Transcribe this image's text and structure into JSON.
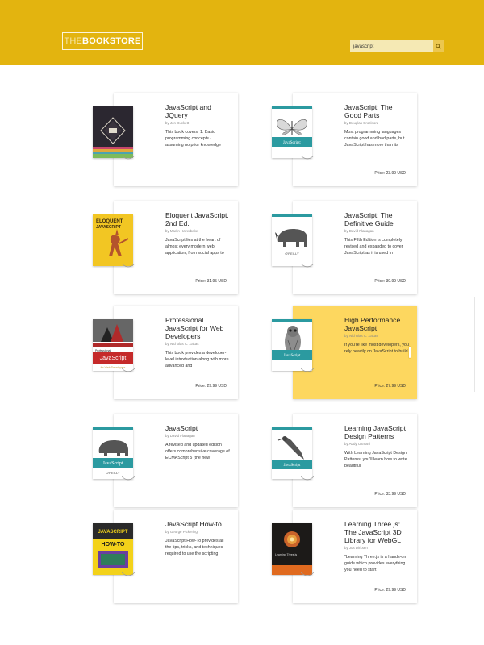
{
  "header": {
    "logo_part1": "THE",
    "logo_part2": "BOOKSTORE",
    "search_value": "javascript",
    "search_icon": "search-icon"
  },
  "books": [
    {
      "title": "JavaScript and JQuery",
      "author": "by Jon Duckett",
      "desc": "This book covers: 1. Basic programming concepts - assuming no prior knowledge",
      "price": ""
    },
    {
      "title": "JavaScript: The Good Parts",
      "author": "by Douglas Crockford",
      "desc": "Most programming languages contain good and bad parts, but JavaScript has more than its",
      "price": "Price: 23.99 USD"
    },
    {
      "title": "Eloquent JavaScript, 2nd Ed.",
      "author": "by Marijn Haverbeke",
      "desc": "JavaScript lies at the heart of almost every modern web application, from social apps to",
      "price": "Price: 31.95 USD"
    },
    {
      "title": "JavaScript: The Definitive Guide",
      "author": "by David Flanagan",
      "desc": "This Fifth Edition is completely revised and expanded to cover JavaScript as it is used in",
      "price": "Price: 39.99 USD"
    },
    {
      "title": "Professional JavaScript for Web Developers",
      "author": "by Nicholas C. Zakas",
      "desc": "This book provides a developer-level introduction along with more advanced and",
      "price": "Price: 29.99 USD"
    },
    {
      "title": "High Performance JavaScript",
      "author": "by Nicholas C. Zakas",
      "desc": "If you're like most developers, you rely heavily on JavaScript to build",
      "price": "Price: 27.99 USD"
    },
    {
      "title": "JavaScript",
      "author": "by David Flanagan",
      "desc": "A revised and updated edition offers comprehensive coverage of ECMAScript 5 (the new",
      "price": ""
    },
    {
      "title": "Learning JavaScript Design Patterns",
      "author": "by Addy Osmani",
      "desc": "With Learning JavaScript Design Patterns, you'll learn how to write beautiful,",
      "price": "Price: 33.99 USD"
    },
    {
      "title": "JavaScript How-to",
      "author": "by George Pickering",
      "desc": "JavaScript How-To provides all the tips, tricks, and techniques required to use the scripting",
      "price": ""
    },
    {
      "title": "Learning Three.js: The JavaScript 3D Library for WebGL",
      "author": "by Jos Dirksen",
      "desc": "\"Learning Three.js is a hands-on guide which provides everything you need to start",
      "price": "Price: 29.99 USD"
    }
  ],
  "covers": {
    "jsjq_text": "JAVASCRIPT & JQUERY",
    "good_parts_text": "JavaScript: The Good Parts",
    "eloquent_text": "ELOQUENT JAVASCRIPT",
    "eloquent_sub": "SECOND EDITION",
    "definitive_text": "JavaScript",
    "pro_text": "JavaScript",
    "pro_sub": "for Web Developers",
    "pro_top": "Professional",
    "hp_text": "JavaScript",
    "js_text": "JavaScript",
    "patterns_text": "JavaScript Design Patterns",
    "howto_text": "JAVASCRIPT",
    "howto_sub": "HOW-TO",
    "three_text": "Learning Three.js: The JavaScript 3D Library for WebGL",
    "oreilly": "O'REILLY"
  },
  "colors": {
    "header": "#e3b40f",
    "highlight_card": "#fdd75f",
    "oreilly_teal": "#2b9aa0"
  }
}
